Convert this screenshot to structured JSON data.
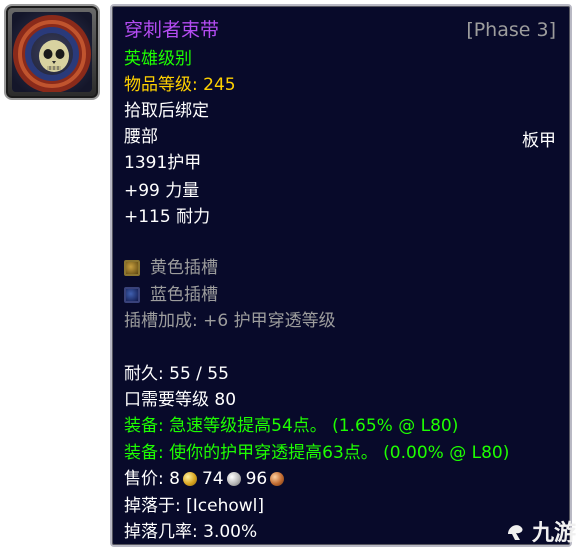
{
  "item": {
    "name": "穿刺者束带",
    "phase": "[Phase 3]",
    "quality": "英雄级别",
    "item_level_label": "物品等级:",
    "item_level_value": "245",
    "bind": "拾取后绑定",
    "slot": "腰部",
    "armor_type": "板甲",
    "armor": "1391护甲",
    "stats": [
      "+99 力量",
      "+115 耐力"
    ],
    "sockets": [
      {
        "label": "黄色插槽",
        "color": "yellow"
      },
      {
        "label": "蓝色插槽",
        "color": "blue"
      }
    ],
    "socket_bonus": "插槽加成: +6 护甲穿透等级",
    "durability": "耐久: 55 / 55",
    "requires_level": "口需要等级 80",
    "equip_effects": [
      "装备: 急速等级提高54点。 (1.65% @ L80)",
      "装备: 使你的护甲穿透提高63点。 (0.00% @ L80)"
    ],
    "sell_price_label": "售价:",
    "sell_gold": "8",
    "sell_silver": "74",
    "sell_copper": "96",
    "dropped_by": "掉落于: [Icehowl]",
    "drop_chance": "掉落几率: 3.00%"
  },
  "colors": {
    "epic": "#b44cf2",
    "green": "#1eff00",
    "yellow": "#ffd100",
    "gray": "#9d9d9d",
    "tooltip_bg": "#080a2a"
  },
  "watermark": {
    "text": "九游"
  },
  "icons": {
    "item_icon": "skull-belt-icon",
    "yellow_socket": "yellow-socket-icon",
    "blue_socket": "blue-socket-icon",
    "gold_coin": "gold-coin-icon",
    "silver_coin": "silver-coin-icon",
    "copper_coin": "copper-coin-icon",
    "watermark_logo": "jiuyou-logo-icon"
  }
}
